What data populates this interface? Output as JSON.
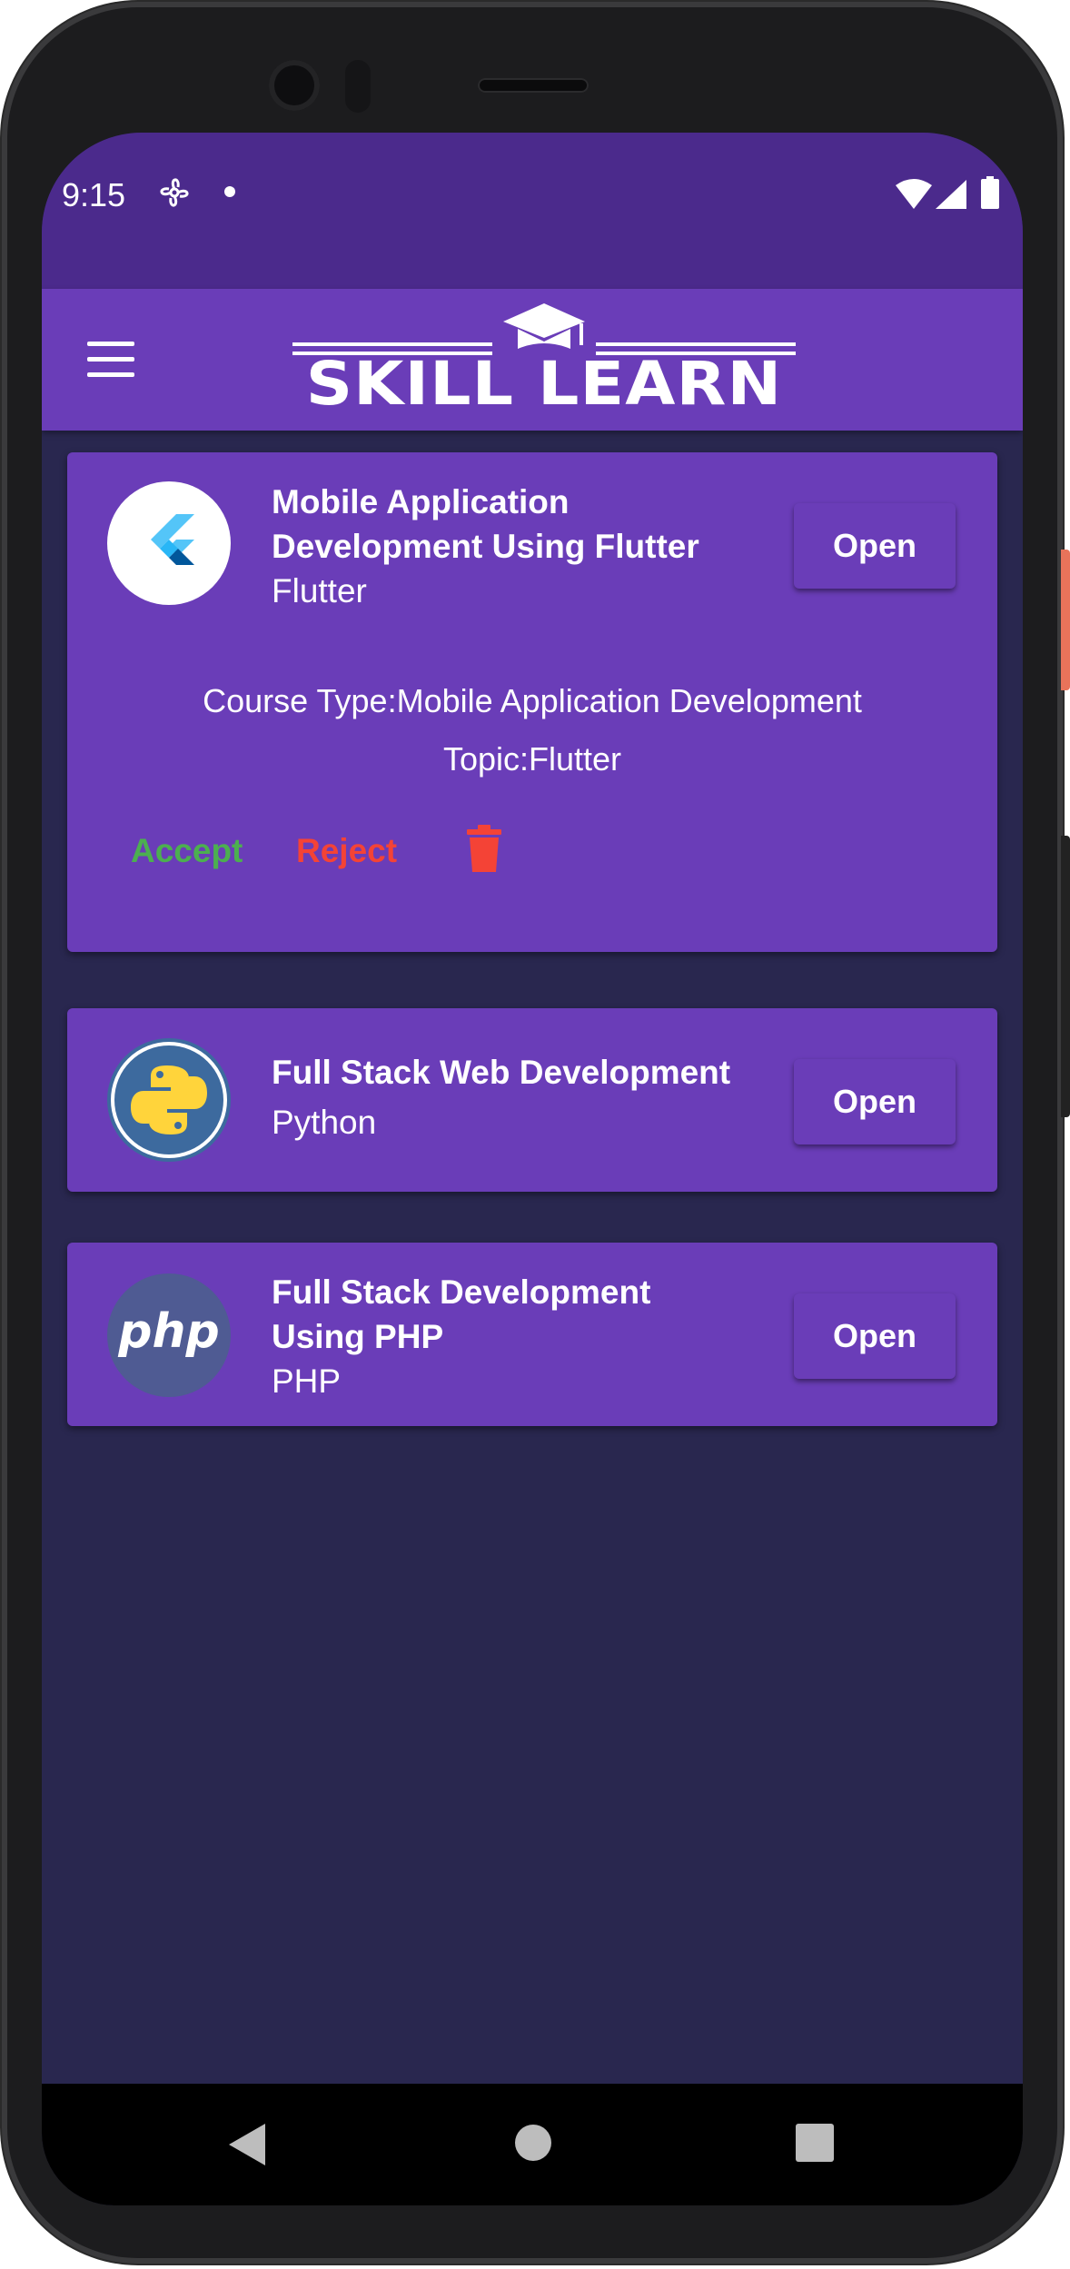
{
  "status_bar": {
    "time": "9:15",
    "icons": [
      "fan-icon",
      "notification-dot-icon",
      "wifi-icon",
      "signal-icon",
      "battery-icon"
    ]
  },
  "app_bar": {
    "menu_icon": "hamburger-menu-icon",
    "logo_text": "SKILL LEARN",
    "logo_icon": "graduation-cap-icon"
  },
  "colors": {
    "status_bar": "#4b2a8c",
    "app_bar": "#6a3db8",
    "background": "#29274f",
    "card": "#6a3db8",
    "accept": "#4caf50",
    "reject": "#f44336"
  },
  "courses": [
    {
      "title_line1": "Mobile Application",
      "title_line2": "Development Using Flutter",
      "subtitle": "Flutter",
      "open_label": "Open",
      "logo": "flutter-logo-icon",
      "course_type": "Course Type:Mobile Application Development",
      "topic": "Topic:Flutter",
      "accept_label": "Accept",
      "reject_label": "Reject",
      "delete_icon": "trash-icon"
    },
    {
      "title_line1": "Full Stack Web Development",
      "subtitle": "Python",
      "open_label": "Open",
      "logo": "python-logo-icon"
    },
    {
      "title_line1": "Full Stack Development",
      "title_line2": "Using PHP",
      "subtitle": "PHP",
      "open_label": "Open",
      "logo": "php-logo-icon",
      "logo_text": "php"
    }
  ],
  "nav_bar": {
    "icons": [
      "back-icon",
      "home-icon",
      "recents-icon"
    ]
  }
}
